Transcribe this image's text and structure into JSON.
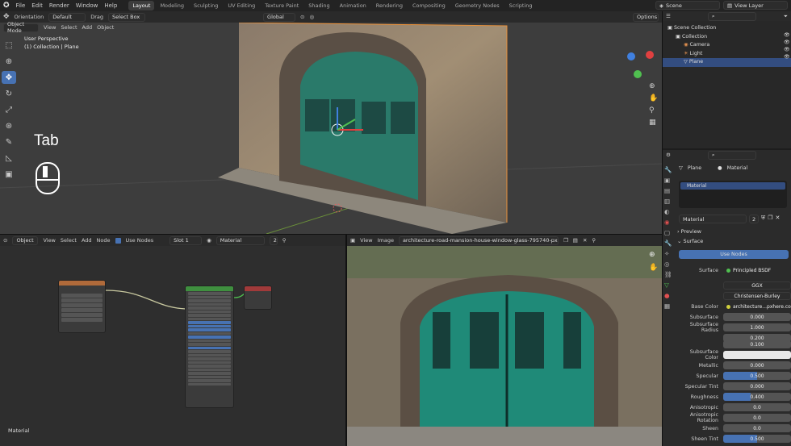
{
  "menu": [
    "File",
    "Edit",
    "Render",
    "Window",
    "Help"
  ],
  "workspaces": [
    "Layout",
    "Modeling",
    "Sculpting",
    "UV Editing",
    "Texture Paint",
    "Shading",
    "Animation",
    "Rendering",
    "Compositing",
    "Geometry Nodes",
    "Scripting"
  ],
  "scene": "Scene",
  "view_layer": "View Layer",
  "viewport": {
    "orientation_label": "Orientation",
    "orientation_value": "Default",
    "drag_label": "Drag",
    "drag_value": "Select Box",
    "transform_space": "Global",
    "options": "Options",
    "mode": "Object Mode",
    "view": "View",
    "select": "Select",
    "add": "Add",
    "object": "Object",
    "perspective": "User Perspective",
    "collection_info": "(1) Collection | Plane",
    "key_overlay": "Tab"
  },
  "outliner": {
    "scene_collection": "Scene Collection",
    "items": [
      "Collection",
      "Camera",
      "Light",
      "Plane"
    ]
  },
  "properties": {
    "breadcrumb_object": "Plane",
    "breadcrumb_material": "Material",
    "slot_name": "Material",
    "material_name": "Material",
    "user_count": "2",
    "preview": "Preview",
    "surface": "Surface",
    "use_nodes": "Use Nodes",
    "surface_label": "Surface",
    "surface_value": "Principled BSDF",
    "distribution": "GGX",
    "subsurface_method": "Christensen-Burley",
    "rows": [
      {
        "label": "Base Color",
        "value": "architecture...pxhere.com",
        "kind": "link"
      },
      {
        "label": "Subsurface",
        "value": "0.000",
        "kind": "num"
      },
      {
        "label": "Subsurface Radius",
        "value": "1.000",
        "kind": "num"
      },
      {
        "label": "",
        "value": "0.200",
        "kind": "num"
      },
      {
        "label": "",
        "value": "0.100",
        "kind": "num"
      },
      {
        "label": "Subsurface Color",
        "value": "",
        "kind": "color"
      },
      {
        "label": "Metallic",
        "value": "0.000",
        "kind": "num"
      },
      {
        "label": "Specular",
        "value": "0.500",
        "kind": "bar",
        "fill": 0.5
      },
      {
        "label": "Specular Tint",
        "value": "0.000",
        "kind": "num"
      },
      {
        "label": "Roughness",
        "value": "0.400",
        "kind": "bar",
        "fill": 0.4
      },
      {
        "label": "Anisotropic",
        "value": "0.0",
        "kind": "num"
      },
      {
        "label": "Anisotropic Rotation",
        "value": "0.0",
        "kind": "num"
      },
      {
        "label": "Sheen",
        "value": "0.0",
        "kind": "num"
      },
      {
        "label": "Sheen Tint",
        "value": "0.500",
        "kind": "bar",
        "fill": 0.5
      }
    ]
  },
  "node_editor": {
    "editor_type": "Object",
    "view": "View",
    "select": "Select",
    "add": "Add",
    "node": "Node",
    "use_nodes": "Use Nodes",
    "slot": "Slot 1",
    "material": "Material",
    "count": "2",
    "footer": "Material"
  },
  "image_editor": {
    "view": "View",
    "image": "Image",
    "filename": "architecture-road-mansion-house-window-glass-795740-pxhere.com"
  }
}
